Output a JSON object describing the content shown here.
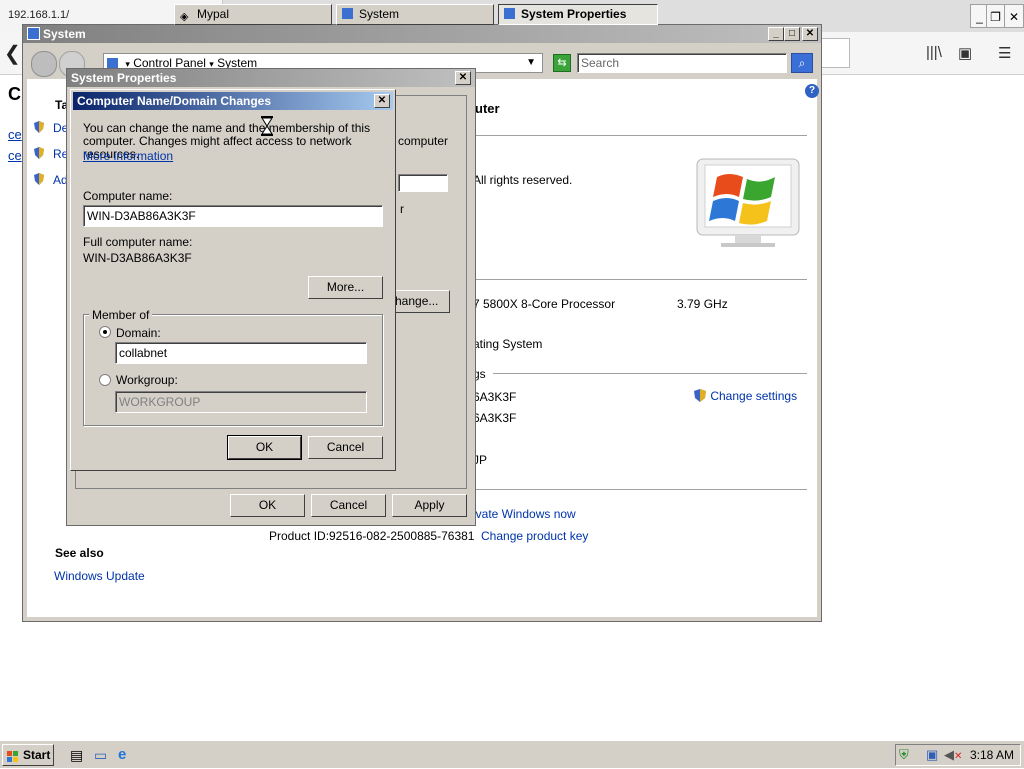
{
  "browser": {
    "tab_title": "192.168.1.1/",
    "tab_close": "✕",
    "new_tab": "+",
    "back": "❮",
    "page_heading_left": "C",
    "left_links": [
      "ce",
      "ce"
    ]
  },
  "system_window": {
    "title": "System",
    "breadcrumb": [
      "Control Panel",
      "System"
    ],
    "search_placeholder": "Search",
    "tasks_heading": "Ta",
    "tasks": [
      "De",
      "Re",
      "Ad"
    ],
    "heading_fragment": "uter",
    "rights": "All rights reserved.",
    "processor": "7 5800X 8-Core Processor",
    "processor_speed": "3.79 GHz",
    "os_type": "ating System",
    "section_settings": "gs",
    "computer_name_frag": "6A3K3F",
    "full_name_frag": "6A3K3F",
    "workgroup_frag": "JP",
    "change_settings": "Change settings",
    "activate": "ivate Windows now",
    "product_id_label": "Product ID:",
    "product_id": "92516-082-2500885-76381",
    "change_product_key": "Change product key",
    "see_also": "See also",
    "windows_update": "Windows Update"
  },
  "sysprops": {
    "title": "System Properties",
    "frag_computer": "computer",
    "frag_r": "r",
    "change_btn": "hange...",
    "ok": "OK",
    "cancel": "Cancel",
    "apply": "Apply"
  },
  "dialog": {
    "title": "Computer Name/Domain Changes",
    "intro": "You can change the name and the membership of this computer. Changes might affect access to network resources.",
    "more_info": "More information",
    "computer_name_label": "Computer name:",
    "computer_name_value": "WIN-D3AB86A3K3F",
    "full_name_label": "Full computer name:",
    "full_name_value": "WIN-D3AB86A3K3F",
    "more_btn": "More...",
    "member_of": "Member of",
    "domain_label": "Domain:",
    "domain_value": "collabnet",
    "domain_selected": true,
    "workgroup_label": "Workgroup:",
    "workgroup_value": "WORKGROUP",
    "ok": "OK",
    "cancel": "Cancel"
  },
  "taskbar": {
    "start": "Start",
    "items": [
      "Mypal",
      "System",
      "System Properties"
    ],
    "clock": "3:18 AM"
  }
}
